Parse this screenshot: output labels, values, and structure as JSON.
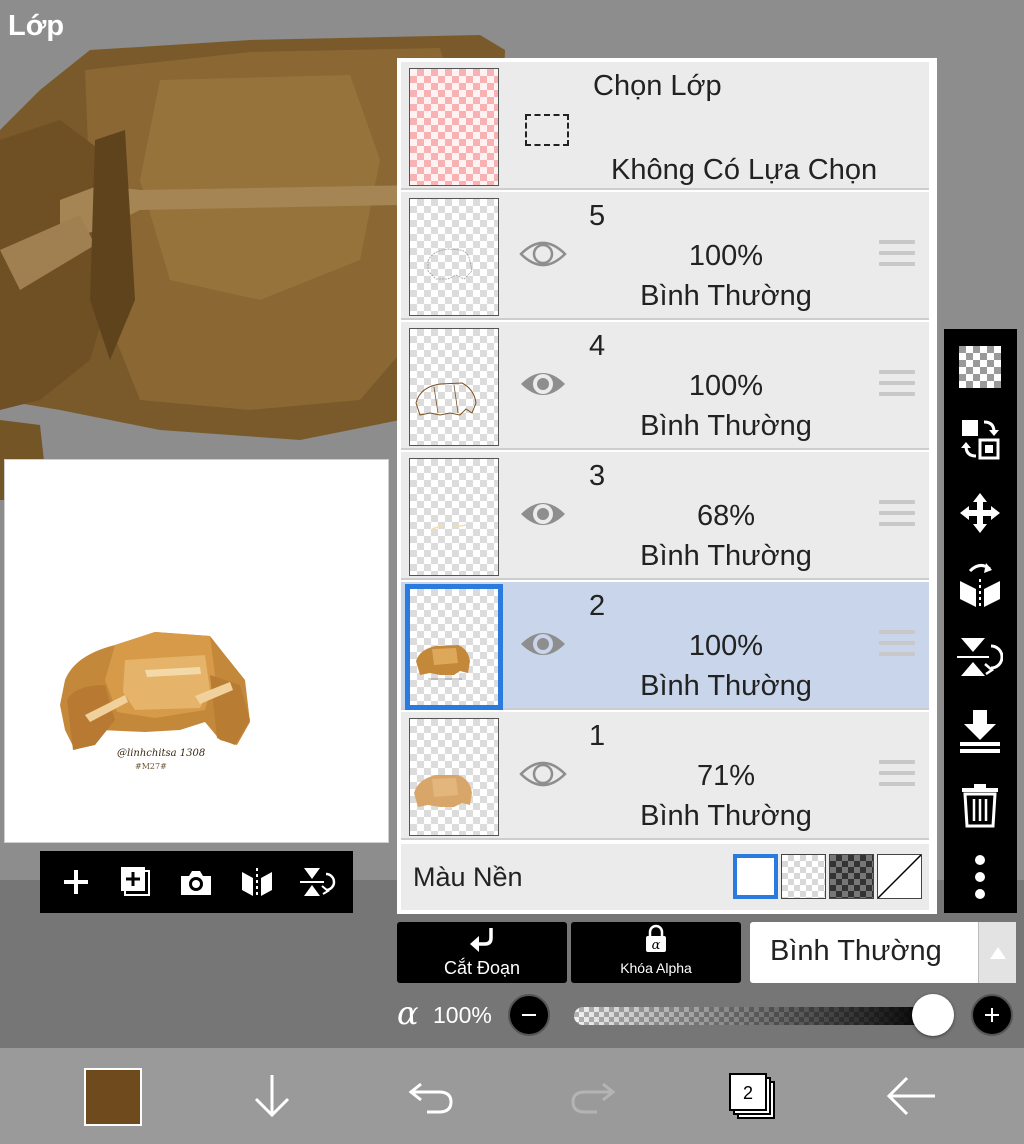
{
  "app": {
    "title": "Lớp"
  },
  "selection_row": {
    "title": "Chọn Lớp",
    "status": "Không Có Lựa Chọn"
  },
  "layers": [
    {
      "number": "5",
      "opacity": "100%",
      "blend": "Bình Thường",
      "visible": true,
      "selected": false
    },
    {
      "number": "4",
      "opacity": "100%",
      "blend": "Bình Thường",
      "visible": true,
      "selected": false
    },
    {
      "number": "3",
      "opacity": "68%",
      "blend": "Bình Thường",
      "visible": true,
      "selected": false
    },
    {
      "number": "2",
      "opacity": "100%",
      "blend": "Bình Thường",
      "visible": true,
      "selected": true
    },
    {
      "number": "1",
      "opacity": "71%",
      "blend": "Bình Thường",
      "visible": true,
      "selected": false
    }
  ],
  "background": {
    "label": "Màu Nền",
    "options": [
      "white",
      "checker-light",
      "checker-dark",
      "none"
    ],
    "selected": "white"
  },
  "actions": {
    "clipping_label": "Cắt Đoạn",
    "alpha_lock_label": "Khóa Alpha"
  },
  "blend_mode": {
    "value": "Bình Thường"
  },
  "alpha": {
    "symbol": "α",
    "value": "100%",
    "level": 1.0
  },
  "preview_signature": {
    "line1": "@linhchitsa 1308",
    "line2": "#M27#"
  },
  "bottom_bar": {
    "layer_count": "2",
    "current_color": "#6f4a1c"
  },
  "colors": {
    "accent": "#2b7ade",
    "selected_row": "#c8d5ea",
    "toolbar": "#000000"
  },
  "right_toolbar": [
    "checker-icon",
    "layer-swap-icon",
    "move-icon",
    "flip-horizontal-icon",
    "flip-vertical-icon",
    "merge-down-icon",
    "trash-icon",
    "more-icon"
  ],
  "preview_toolbar": [
    "add-layer-icon",
    "duplicate-layer-icon",
    "camera-icon",
    "flip-horizontal-icon",
    "flip-vertical-icon"
  ]
}
